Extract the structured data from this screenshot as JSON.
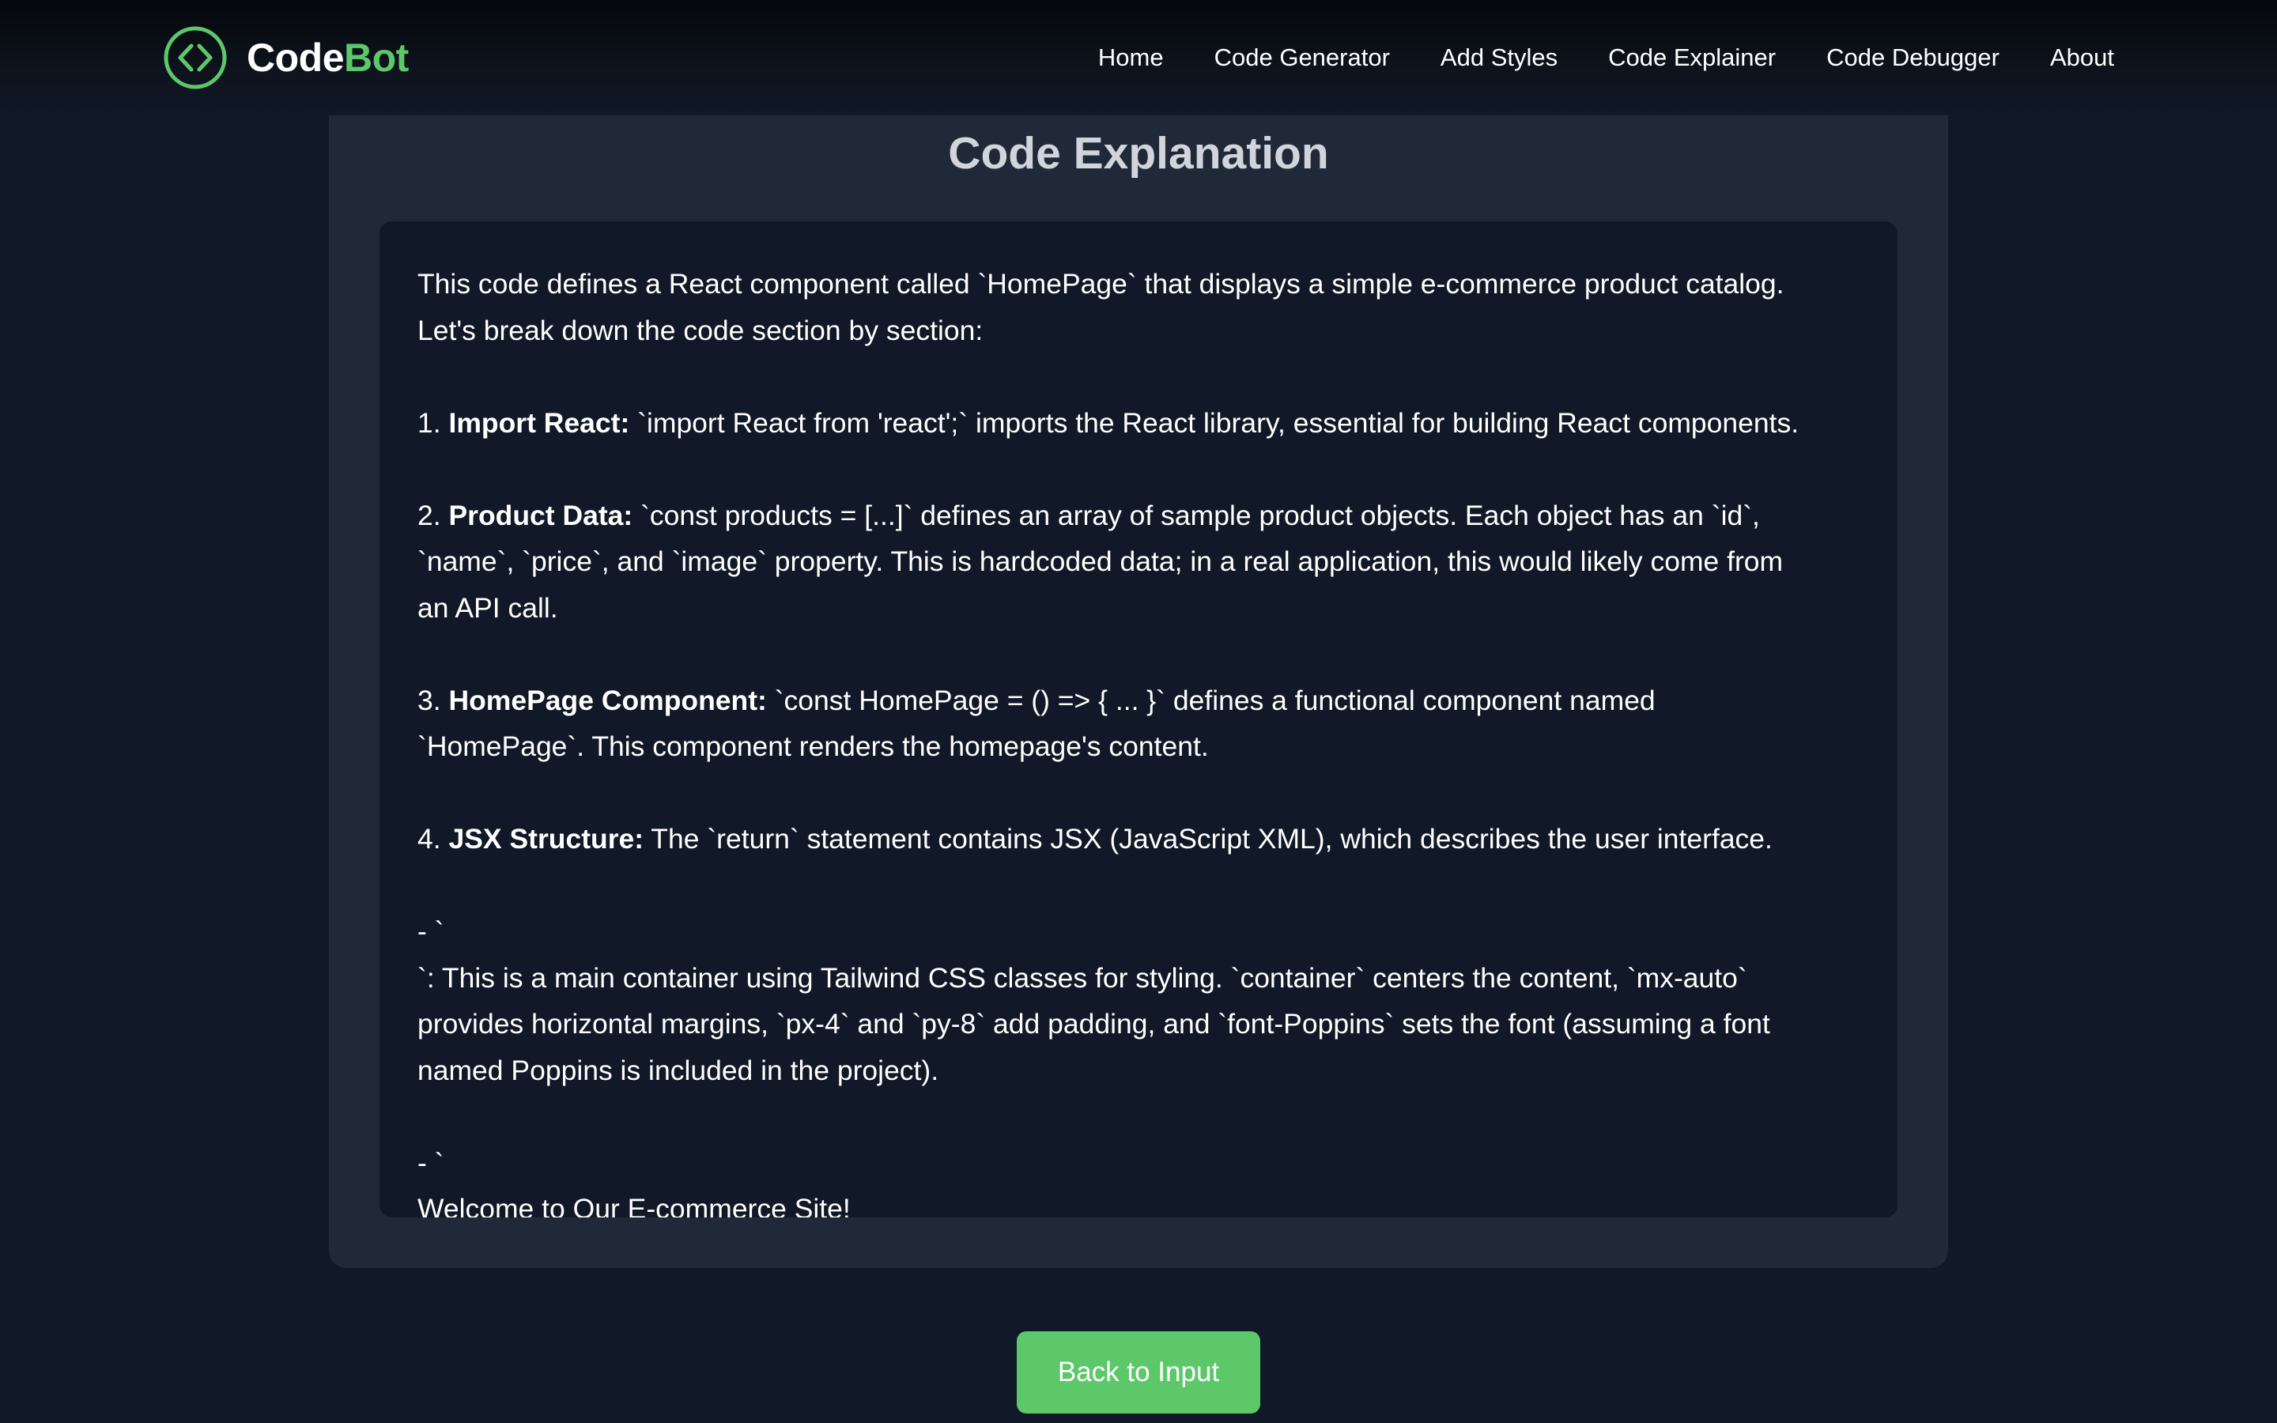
{
  "header": {
    "brand": {
      "code": "Code",
      "bot": "Bot",
      "icon": "code-brackets-circle-icon"
    },
    "nav": [
      {
        "label": "Home"
      },
      {
        "label": "Code Generator"
      },
      {
        "label": "Add Styles"
      },
      {
        "label": "Code Explainer"
      },
      {
        "label": "Code Debugger"
      },
      {
        "label": "About"
      }
    ]
  },
  "main": {
    "title": "Code Explanation",
    "lines": {
      "intro_1": "This code defines a React component called `HomePage` that displays a simple e-commerce product catalog.",
      "intro_2": "Let's break down the code section by section:",
      "item1_num": "1. ",
      "item1_bold": "Import React:",
      "item1_text": " `import React from 'react';` imports the React library, essential for building React components.",
      "item2_num": "2. ",
      "item2_bold": "Product Data:",
      "item2_text_1": " `const products = [...]` defines an array of sample product objects. Each object has an `id`,",
      "item2_text_2": "`name`, `price`, and `image` property. This is hardcoded data; in a real application, this would likely come from",
      "item2_text_3": "an API call.",
      "item3_num": "3. ",
      "item3_bold": "HomePage Component:",
      "item3_text_1": " `const HomePage = () => { ... }` defines a functional component named",
      "item3_text_2": "`HomePage`. This component renders the homepage's content.",
      "item4_num": "4. ",
      "item4_bold": "JSX Structure:",
      "item4_text": " The `return` statement contains JSX (JavaScript XML), which describes the user interface.",
      "sub1_marker": "- `",
      "sub1_text_1": "`: This is a main container using Tailwind CSS classes for styling. `container` centers the content, `mx-auto`",
      "sub1_text_2": "provides horizontal margins, `px-4` and `py-8` add padding, and `font-Poppins` sets the font (assuming a font",
      "sub1_text_3": "named Poppins is included in the project).",
      "sub2_marker": "- `",
      "sub2_text_1": "Welcome to Our E-commerce Site!"
    }
  },
  "footer": {
    "back_button": "Back to Input"
  },
  "colors": {
    "background": "#111827",
    "card": "#1f2937",
    "accent": "#5cc86a",
    "text": "#ffffff"
  }
}
